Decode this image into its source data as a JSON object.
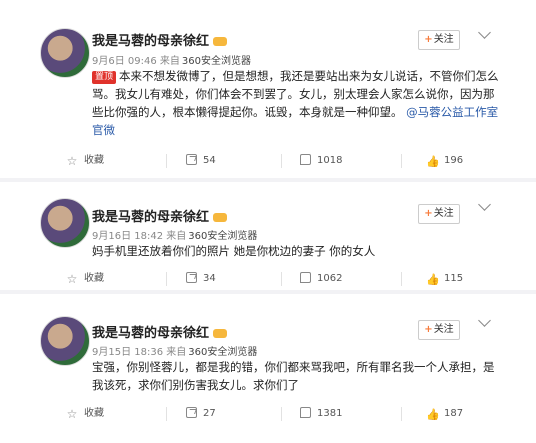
{
  "posts": [
    {
      "author": "我是马蓉的母亲徐红",
      "time": "9月6日 09:46",
      "via": "来自",
      "source": "360安全浏览器",
      "follow_label": "关注",
      "hot_badge": "置顶",
      "text": "本来不想发微博了，但是想想，我还是要站出来为女儿说话，不管你们怎么骂。我女儿有难处，你们体会不到罢了。女儿，别太理会人家怎么说你，因为那些比你强的人，根本懒得提起你。诋毁，本身就是一种仰望。",
      "mention": "@马蓉公益工作室官微",
      "actions": {
        "favorite": "收藏",
        "forward": "54",
        "comment": "1018",
        "like": "196"
      }
    },
    {
      "author": "我是马蓉的母亲徐红",
      "time": "9月16日 18:42",
      "via": "来自",
      "source": "360安全浏览器",
      "follow_label": "关注",
      "text": "妈手机里还放着你们的照片 她是你枕边的妻子 你的女人",
      "actions": {
        "favorite": "收藏",
        "forward": "34",
        "comment": "1062",
        "like": "115"
      }
    },
    {
      "author": "我是马蓉的母亲徐红",
      "time": "9月15日 18:36",
      "via": "来自",
      "source": "360安全浏览器",
      "follow_label": "关注",
      "text": "宝强，你别怪蓉儿，都是我的错，你们都来骂我吧，所有罪名我一个人承担，是我该死，求你们别伤害我女儿。求你们了",
      "actions": {
        "favorite": "收藏",
        "forward": "27",
        "comment": "1381",
        "like": "187"
      }
    }
  ],
  "icons": {
    "favorite": "star-icon",
    "forward": "forward-icon",
    "comment": "comment-icon",
    "like": "thumbs-up-icon",
    "more": "chevron-down-icon"
  }
}
